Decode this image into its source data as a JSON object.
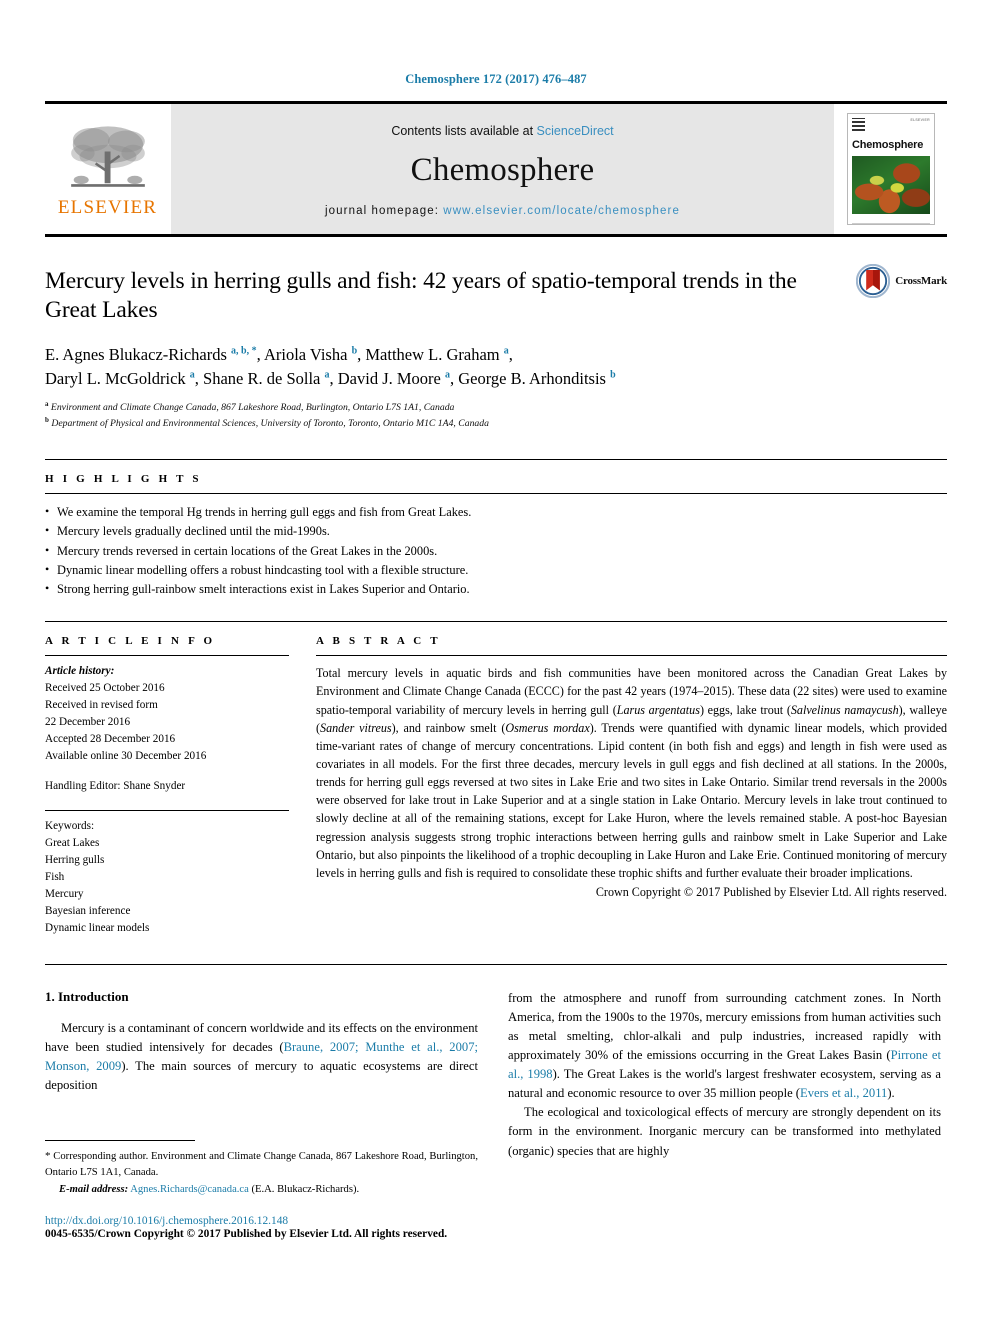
{
  "running_head": "Chemosphere 172 (2017) 476–487",
  "masthead": {
    "publisher_logo_text": "ELSEVIER",
    "contents_prefix": "Contents lists available at",
    "contents_link": "ScienceDirect",
    "journal_name": "Chemosphere",
    "homepage_prefix": "journal homepage:",
    "homepage_url": "www.elsevier.com/locate/chemosphere",
    "cover_title": "Chemosphere",
    "cover_publisher": "ELSEVIER"
  },
  "article": {
    "title": "Mercury levels in herring gulls and fish: 42 years of spatio-temporal trends in the Great Lakes",
    "crossmark_label": "CrossMark",
    "authors_line_1": "E. Agnes Blukacz-Richards <sup>a, b, *</sup>, Ariola Visha <sup>b</sup>, Matthew L. Graham <sup>a</sup>,",
    "authors_line_2": "Daryl L. McGoldrick <sup>a</sup>, Shane R. de Solla <sup>a</sup>, David J. Moore <sup>a</sup>, George B. Arhonditsis <sup>b</sup>",
    "affiliation_a": "Environment and Climate Change Canada, 867 Lakeshore Road, Burlington, Ontario L7S 1A1, Canada",
    "affiliation_b": "Department of Physical and Environmental Sciences, University of Toronto, Toronto, Ontario M1C 1A4, Canada"
  },
  "highlights": {
    "heading": "H I G H L I G H T S",
    "items": [
      "We examine the temporal Hg trends in herring gull eggs and fish from Great Lakes.",
      "Mercury levels gradually declined until the mid-1990s.",
      "Mercury trends reversed in certain locations of the Great Lakes in the 2000s.",
      "Dynamic linear modelling offers a robust hindcasting tool with a flexible structure.",
      "Strong herring gull-rainbow smelt interactions exist in Lakes Superior and Ontario."
    ]
  },
  "article_info": {
    "heading": "A R T I C L E   I N F O",
    "history_label": "Article history:",
    "history_lines": [
      "Received 25 October 2016",
      "Received in revised form",
      "22 December 2016",
      "Accepted 28 December 2016",
      "Available online 30 December 2016"
    ],
    "handling_editor": "Handling Editor: Shane Snyder",
    "keywords_label": "Keywords:",
    "keywords": [
      "Great Lakes",
      "Herring gulls",
      "Fish",
      "Mercury",
      "Bayesian inference",
      "Dynamic linear models"
    ]
  },
  "abstract": {
    "heading": "A B S T R A C T",
    "text_html": "Total mercury levels in aquatic birds and fish communities have been monitored across the Canadian Great Lakes by Environment and Climate Change Canada (ECCC) for the past 42 years (1974–2015). These data (22 sites) were used to examine spatio-temporal variability of mercury levels in herring gull (<i>Larus argentatus</i>) eggs, lake trout (<i>Salvelinus namaycush</i>), walleye (<i>Sander vitreus</i>), and rainbow smelt (<i>Osmerus mordax</i>). Trends were quantified with dynamic linear models, which provided time-variant rates of change of mercury concentrations. Lipid content (in both fish and eggs) and length in fish were used as covariates in all models. For the first three decades, mercury levels in gull eggs and fish declined at all stations. In the 2000s, trends for herring gull eggs reversed at two sites in Lake Erie and two sites in Lake Ontario. Similar trend reversals in the 2000s were observed for lake trout in Lake Superior and at a single station in Lake Ontario. Mercury levels in lake trout continued to slowly decline at all of the remaining stations, except for Lake Huron, where the levels remained stable. A post-hoc Bayesian regression analysis suggests strong trophic interactions between herring gulls and rainbow smelt in Lake Superior and Lake Ontario, but also pinpoints the likelihood of a trophic decoupling in Lake Huron and Lake Erie. Continued monitoring of mercury levels in herring gulls and fish is required to consolidate these trophic shifts and further evaluate their broader implications.",
    "copyright": "Crown Copyright © 2017 Published by Elsevier Ltd. All rights reserved."
  },
  "body": {
    "section_heading": "1. Introduction",
    "left_paragraph_html": "Mercury is a contaminant of concern worldwide and its effects on the environment have been studied intensively for decades (<span class=\"cite\">Braune, 2007; Munthe et al., 2007; Monson, 2009</span>). The main sources of mercury to aquatic ecosystems are direct deposition",
    "right_paragraph_1_html": "from the atmosphere and runoff from surrounding catchment zones. In North America, from the 1900s to the 1970s, mercury emissions from human activities such as metal smelting, chlor-alkali and pulp industries, increased rapidly with approximately 30% of the emissions occurring in the Great Lakes Basin (<span class=\"cite\">Pirrone et al., 1998</span>). The Great Lakes is the world's largest freshwater ecosystem, serving as a natural and economic resource to over 35 million people (<span class=\"cite\">Evers et al., 2011</span>).",
    "right_paragraph_2_html": "The ecological and toxicological effects of mercury are strongly dependent on its form in the environment. Inorganic mercury can be transformed into methylated (organic) species that are highly"
  },
  "footnote": {
    "corresponding_html": "<span class=\"star\">*</span> Corresponding author. Environment and Climate Change Canada, 867 Lakeshore Road, Burlington, Ontario L7S 1A1, Canada.",
    "email_label": "E-mail address:",
    "email_address": "Agnes.Richards@canada.ca",
    "email_owner": "(E.A. Blukacz-Richards).",
    "doi_url": "http://dx.doi.org/10.1016/j.chemosphere.2016.12.148",
    "issn_line": "0045-6535/Crown Copyright © 2017 Published by Elsevier Ltd. All rights reserved."
  },
  "colors": {
    "link_blue": "#1b7ca8",
    "elsevier_orange": "#E77500",
    "masthead_grey": "#e6e6e6"
  }
}
